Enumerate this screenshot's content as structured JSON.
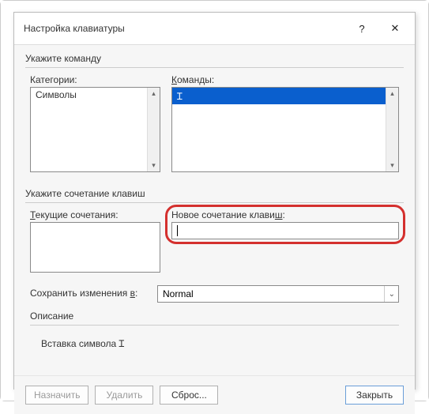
{
  "title": "Настройка клавиатуры",
  "section_command": "Укажите команду",
  "categories_label": "Категории:",
  "categories_item": "Символы",
  "commands_label": "Команды:",
  "commands_label_ul": "К",
  "commands_item": "Ɪ",
  "section_shortcut": "Укажите сочетание клавиш",
  "current_label": "Текущие сочетания:",
  "current_label_ul": "Т",
  "new_label": "Новое сочетание клавиш:",
  "new_label_ul": "ш",
  "save_label": "Сохранить изменения в:",
  "save_label_ul": "в",
  "save_value": "Normal",
  "desc_heading": "Описание",
  "desc_text": "Вставка символа Ɪ",
  "btn_assign": "Назначить",
  "btn_delete": "Удалить",
  "btn_reset": "Сброс...",
  "btn_close": "Закрыть",
  "help_icon": "?",
  "close_icon": "✕"
}
